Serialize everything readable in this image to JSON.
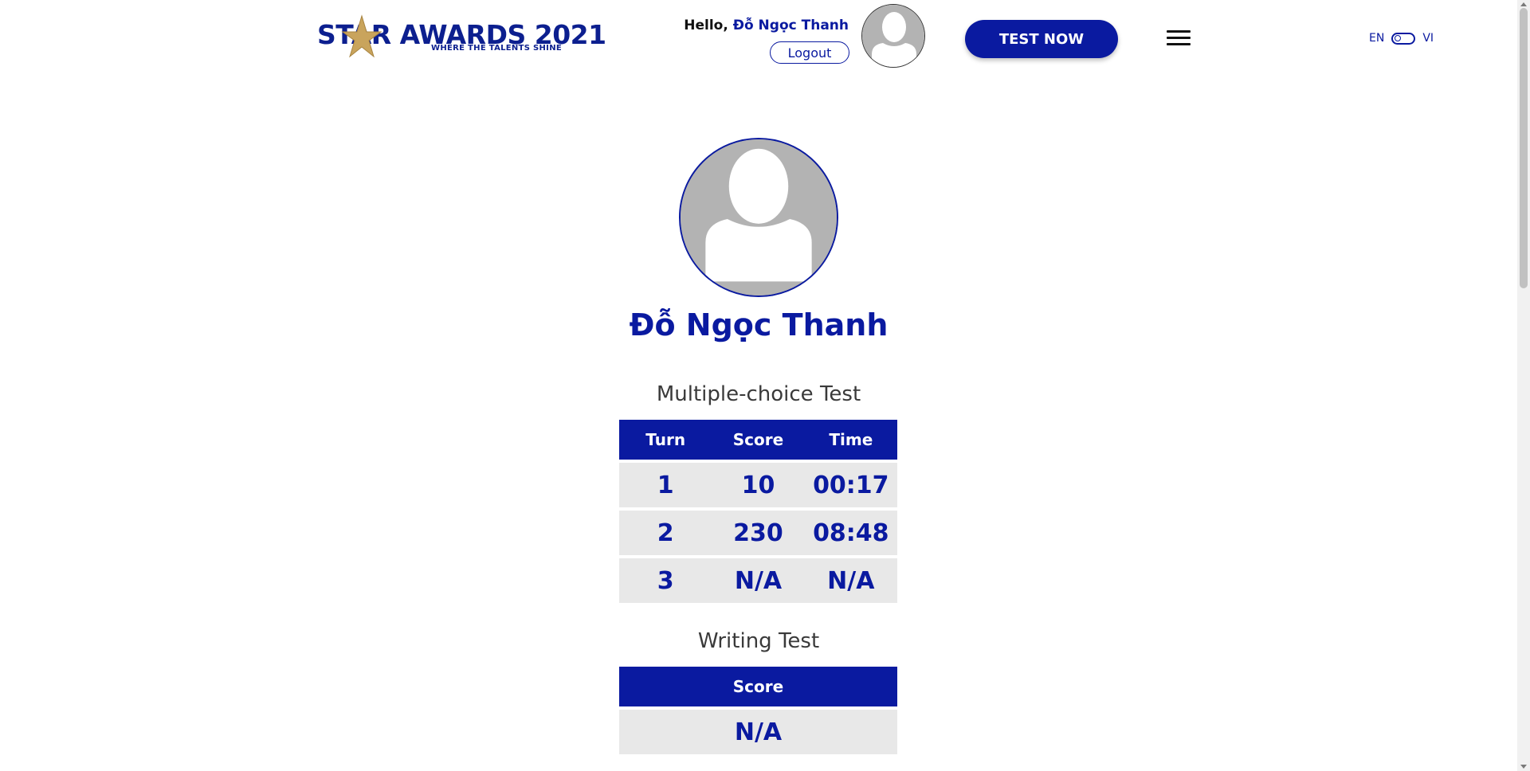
{
  "header": {
    "logo_text": "ST AR AWARDS 2021",
    "logo_main": "STAR AWARDS 2021",
    "logo_tagline": "WHERE THE TALENTS SHINE",
    "greeting_prefix": "Hello, ",
    "user_name": "Đỗ Ngọc Thanh",
    "logout_label": "Logout",
    "test_now_label": "TEST NOW",
    "lang_en": "EN",
    "lang_vi": "VI"
  },
  "profile": {
    "name": "Đỗ Ngọc Thanh"
  },
  "multiple_choice": {
    "title": "Multiple-choice Test",
    "columns": [
      "Turn",
      "Score",
      "Time"
    ],
    "rows": [
      [
        "1",
        "10",
        "00:17"
      ],
      [
        "2",
        "230",
        "08:48"
      ],
      [
        "3",
        "N/A",
        "N/A"
      ]
    ]
  },
  "writing": {
    "title": "Writing Test",
    "columns": [
      "Score"
    ],
    "rows": [
      [
        "N/A"
      ]
    ]
  },
  "colors": {
    "brand_blue": "#0a1aa0",
    "logo_gold": "#c9a45c",
    "row_background": "#e8e8e8"
  }
}
